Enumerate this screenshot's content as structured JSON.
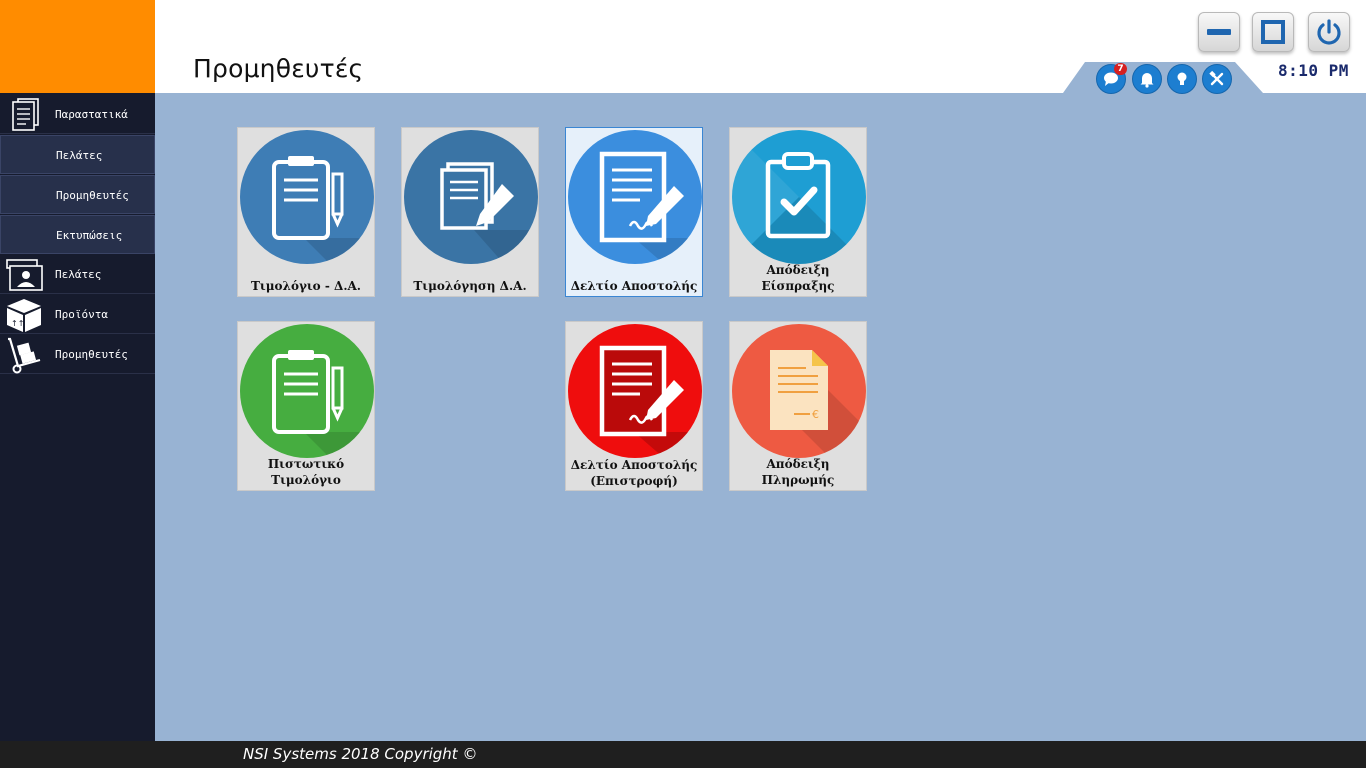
{
  "header": {
    "title": "Προμηθευτές",
    "clock": "8:10 PM",
    "notification_count": "7",
    "window_buttons": [
      "minimize-icon",
      "maximize-icon",
      "power-icon"
    ],
    "tray_icons": [
      "chat-icon",
      "bell-icon",
      "lightbulb-icon",
      "tools-icon"
    ]
  },
  "sidebar": {
    "items": [
      {
        "label": "Παραστατικά",
        "icon": "documents-icon"
      },
      {
        "label": "Πελάτες"
      },
      {
        "label": "Προμηθευτές"
      },
      {
        "label": "Εκτυπώσεις"
      },
      {
        "label": "Πελάτες",
        "icon": "customer-card-icon"
      },
      {
        "label": "Προϊόντα",
        "icon": "package-icon"
      },
      {
        "label": "Προμηθευτές",
        "icon": "hand-truck-icon"
      }
    ]
  },
  "tiles": [
    {
      "label": "Τιμολόγιο - Δ.Α.",
      "color": "#3e7db5",
      "icon": "clipboard-pen-icon"
    },
    {
      "label": "Τιμολόγηση Δ.Α.",
      "color": "#3a74a5",
      "icon": "documents-pen-icon"
    },
    {
      "label": "Δελτίο Αποστολής",
      "color": "#3b8ede",
      "icon": "signed-document-icon"
    },
    {
      "label": "Απόδειξη Είσπραξης",
      "color": "#1e9ed3",
      "icon": "clipboard-check-icon"
    },
    {
      "label": "Πιστωτικό Τιμολόγιο",
      "color": "#46ad40",
      "icon": "clipboard-pen-icon"
    },
    {
      "label": "Δελτίο Αποστολής (Επιστροφή)",
      "color": "#ef0d0d",
      "icon": "signed-document-icon"
    },
    {
      "label": "Απόδειξη Πληρωμής",
      "color": "#ee5a42",
      "icon": "receipt-euro-icon"
    }
  ],
  "footer": {
    "copyright": "NSI Systems 2018 Copyright ©"
  }
}
